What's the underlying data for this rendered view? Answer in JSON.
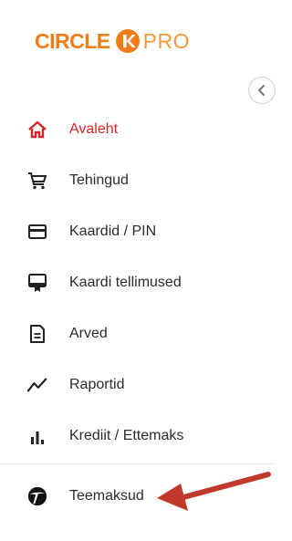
{
  "brand": {
    "name": "CIRCLE",
    "k": "K",
    "suffix": "PRO",
    "color": "#ee7d1a"
  },
  "sidebar": {
    "items": [
      {
        "label": "Avaleht",
        "icon": "home-icon",
        "active": true
      },
      {
        "label": "Tehingud",
        "icon": "cart-icon"
      },
      {
        "label": "Kaardid / PIN",
        "icon": "card-icon"
      },
      {
        "label": "Kaardi tellimused",
        "icon": "card-order-icon"
      },
      {
        "label": "Arved",
        "icon": "invoice-icon"
      },
      {
        "label": "Raportid",
        "icon": "trend-icon"
      },
      {
        "label": "Krediit / Ettemaks",
        "icon": "bar-chart-icon"
      }
    ],
    "bottom_item": {
      "label": "Teemaksud",
      "icon": "toll-icon"
    }
  },
  "colors": {
    "active": "#d8232a",
    "annotation_arrow": "#c0392b"
  }
}
